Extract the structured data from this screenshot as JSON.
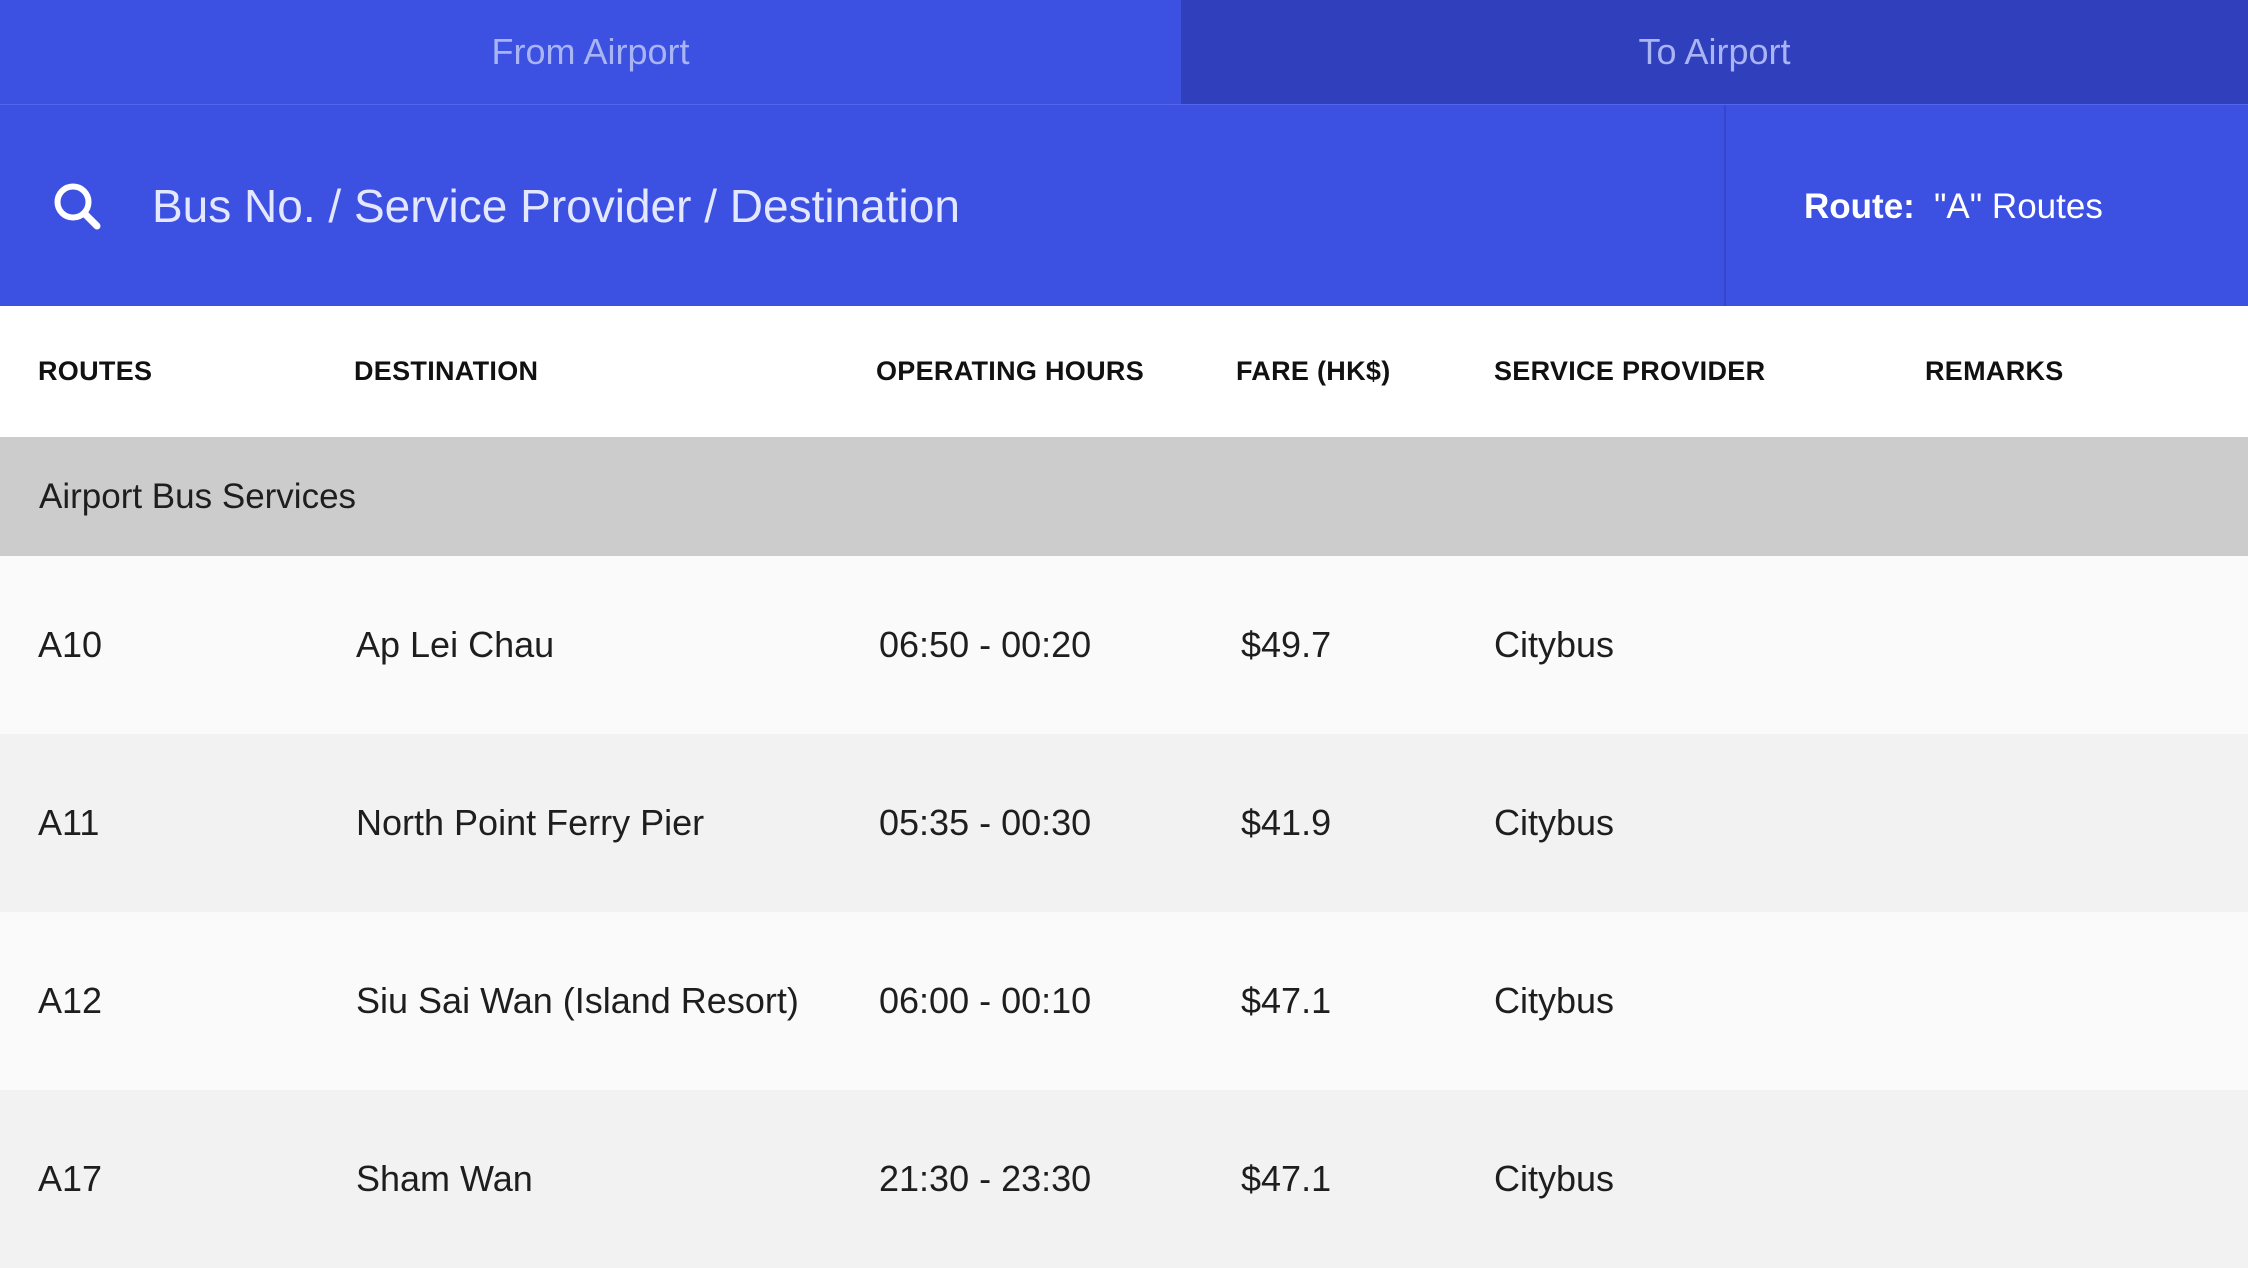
{
  "tabs": [
    {
      "label": "From Airport"
    },
    {
      "label": "To Airport"
    }
  ],
  "search": {
    "placeholder": "Bus No. / Service Provider / Destination",
    "value": ""
  },
  "route_filter": {
    "label": "Route:",
    "selected": "\"A\" Routes"
  },
  "table": {
    "headers": {
      "routes": "ROUTES",
      "destination": "DESTINATION",
      "operating_hours": "OPERATING HOURS",
      "fare": "FARE (HK$)",
      "service_provider": "SERVICE PROVIDER",
      "remarks": "REMARKS"
    },
    "group_label": "Airport Bus Services",
    "rows": [
      {
        "route": "A10",
        "destination": "Ap Lei Chau",
        "hours": "06:50 - 00:20",
        "fare": "$49.7",
        "provider": "Citybus",
        "remarks": ""
      },
      {
        "route": "A11",
        "destination": "North Point Ferry Pier",
        "hours": "05:35 - 00:30",
        "fare": "$41.9",
        "provider": "Citybus",
        "remarks": ""
      },
      {
        "route": "A12",
        "destination": "Siu Sai Wan (Island Resort)",
        "hours": "06:00 - 00:10",
        "fare": "$47.1",
        "provider": "Citybus",
        "remarks": ""
      },
      {
        "route": "A17",
        "destination": "Sham Wan",
        "hours": "21:30 - 23:30",
        "fare": "$47.1",
        "provider": "Citybus",
        "remarks": ""
      }
    ]
  },
  "colors": {
    "primary": "#3c50e2",
    "tab_inactive": "#3040bc",
    "group_bg": "#cccccc"
  }
}
